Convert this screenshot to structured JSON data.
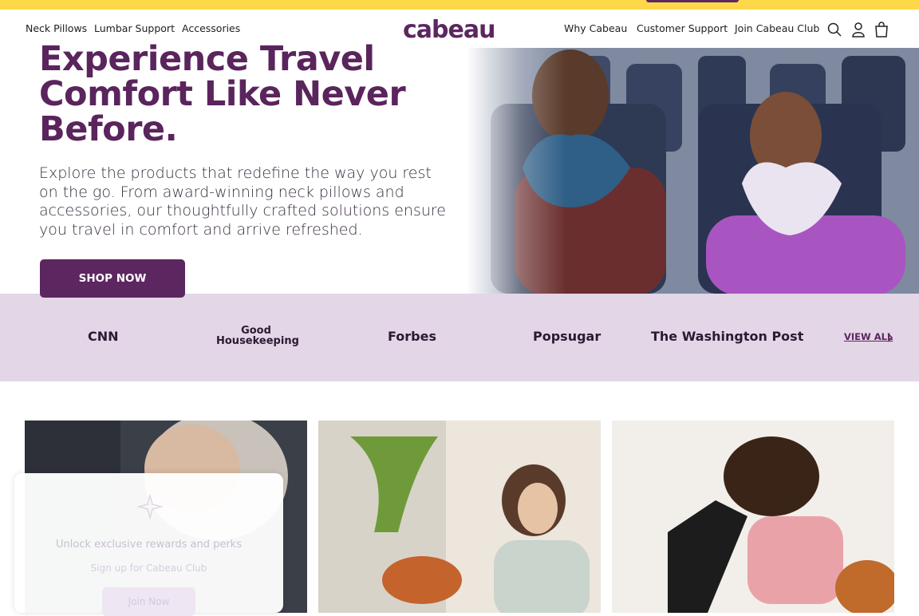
{
  "nav": {
    "left_links": [
      "Neck Pillows",
      "Lumbar Support",
      "Accessories"
    ],
    "logo": "cabeau",
    "right_links": [
      "Why Cabeau",
      "Customer Support",
      "Join Cabeau Club"
    ],
    "icons": [
      "search-icon",
      "account-icon",
      "cart-icon"
    ]
  },
  "hero": {
    "title": "Experience Travel Comfort Like Never Before.",
    "body": "Explore the products that redefine the way you rest on the go. From award-winning neck pillows and accessories, our thoughtfully crafted solutions ensure you travel in comfort and arrive refreshed.",
    "cta": "SHOP NOW"
  },
  "press": {
    "logos": [
      "CNN",
      "Good Housekeeping",
      "Forbes",
      "Popsugar",
      "The Washington Post"
    ],
    "view_all": "VIEW ALL"
  },
  "popup": {
    "line1": "Unlock exclusive rewards and perks",
    "line2": "Sign up for Cabeau Club",
    "button": "Join Now"
  },
  "colors": {
    "brand": "#5c2660",
    "promo_bar": "#ffd84a",
    "press_band": "#e3d6e6"
  }
}
